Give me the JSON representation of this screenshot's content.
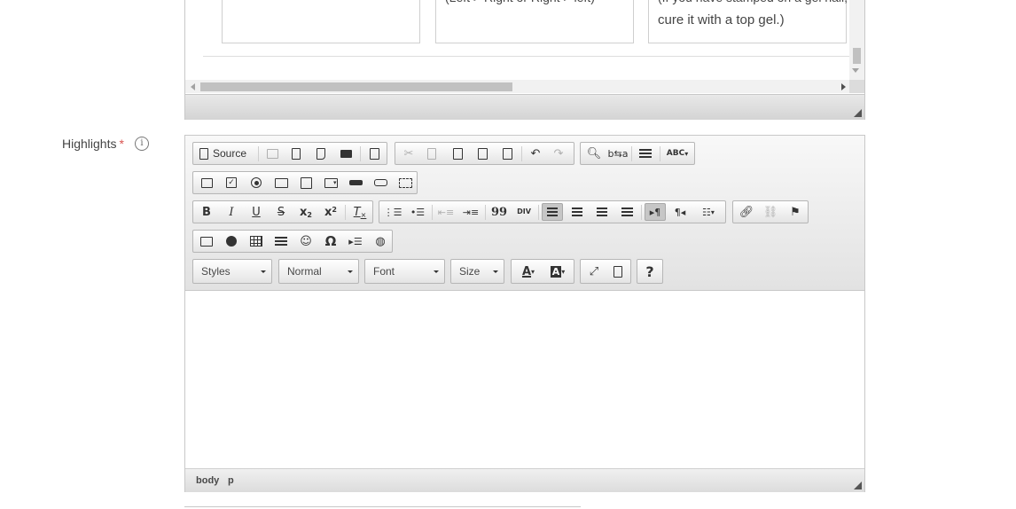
{
  "upper_editor": {
    "cell_left_text": "",
    "cell_mid_text": "(Left > Right  or  Right > left)",
    "cell_right_line1": "(If you have stamped on a gel nail,",
    "cell_right_line2": "cure it with a top gel.)"
  },
  "field": {
    "label": "Highlights",
    "required_mark": "*",
    "info_icon": "i"
  },
  "toolbar": {
    "source_label": "Source",
    "styles_label": "Styles",
    "format_label": "Normal",
    "font_label": "Font",
    "size_label": "Size",
    "help_label": "?",
    "bold": "B",
    "italic": "I",
    "underline": "U",
    "strike": "S",
    "subscript": "x",
    "superscript": "x",
    "clear_format": "T",
    "blockquote": "99",
    "omega": "Ω",
    "text_color": "A",
    "bg_color": "A",
    "spell": "ABC"
  },
  "status_bar": {
    "path": [
      "body",
      "p"
    ]
  }
}
